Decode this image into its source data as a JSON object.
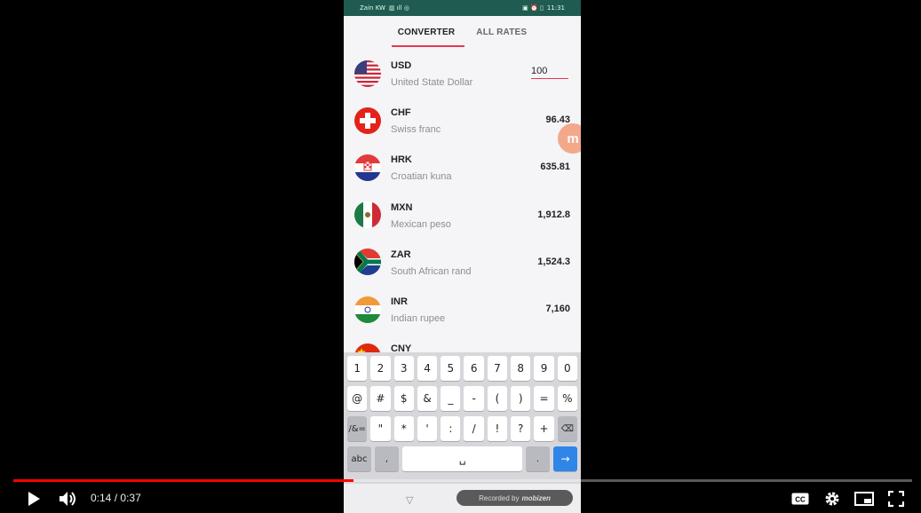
{
  "status_bar": {
    "carrier": "Zain KW",
    "time": "11:31"
  },
  "tabs": [
    {
      "label": "CONVERTER",
      "active": true
    },
    {
      "label": "ALL RATES",
      "active": false
    }
  ],
  "currencies": [
    {
      "code": "USD",
      "name": "United State Dollar",
      "value": "100",
      "is_input": true,
      "flag": "us-flag-icon"
    },
    {
      "code": "CHF",
      "name": "Swiss franc",
      "value": "96.43",
      "flag": "switzerland-flag-icon"
    },
    {
      "code": "HRK",
      "name": "Croatian kuna",
      "value": "635.81",
      "flag": "croatia-flag-icon"
    },
    {
      "code": "MXN",
      "name": "Mexican peso",
      "value": "1,912.8",
      "flag": "mexico-flag-icon"
    },
    {
      "code": "ZAR",
      "name": "South African rand",
      "value": "1,524.3",
      "flag": "south-africa-flag-icon"
    },
    {
      "code": "INR",
      "name": "Indian rupee",
      "value": "7,160",
      "flag": "india-flag-icon"
    },
    {
      "code": "CNY",
      "name": "",
      "value": "",
      "flag": "china-flag-icon"
    }
  ],
  "floating_bubble": {
    "label": "m"
  },
  "keyboard": {
    "row1": [
      "1",
      "2",
      "3",
      "4",
      "5",
      "6",
      "7",
      "8",
      "9",
      "0"
    ],
    "row2": [
      "@",
      "#",
      "$",
      "&",
      "_",
      "-",
      "(",
      ")",
      "=",
      "%"
    ],
    "row3": [
      "/&=",
      "\"",
      "*",
      "'",
      ":",
      "/",
      "!",
      "?",
      "+"
    ],
    "row4": {
      "abc": "abc",
      "comma": ",",
      "period": "."
    }
  },
  "recorded_badge": {
    "prefix": "Recorded by",
    "brand": "mobizen"
  },
  "player": {
    "current_time": "0:14",
    "separator": "/",
    "duration": "0:37",
    "progress_fraction": 0.378,
    "accent_color": "#ff0000",
    "icons": [
      "play-icon",
      "volume-icon",
      "cc-icon",
      "settings-icon",
      "miniplayer-icon",
      "fullscreen-icon"
    ]
  },
  "colors": {
    "accent": "#e53950",
    "status_bar": "#1f5b50",
    "keyboard_enter": "#2f86e8"
  }
}
